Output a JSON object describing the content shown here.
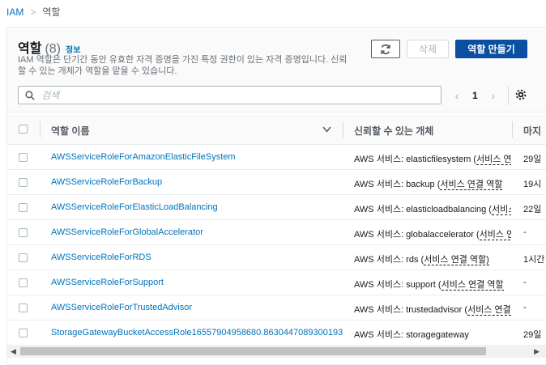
{
  "breadcrumb": {
    "root": "IAM",
    "separator": ">",
    "current": "역할"
  },
  "header": {
    "title": "역할",
    "count": "(8)",
    "info": "정보",
    "description": "IAM 역할은 단기간 동안 유효한 자격 증명을 가진 특정 권한이 있는 자격 증명입니다. 신뢰할 수 있는 개체가 역할을 맡을 수 있습니다."
  },
  "buttons": {
    "delete": "삭제",
    "create": "역할 만들기"
  },
  "search": {
    "placeholder": "검색",
    "value": ""
  },
  "pagination": {
    "prev": "‹",
    "page": "1",
    "next": "›"
  },
  "table": {
    "columns": {
      "role_name": "역할 이름",
      "trusted_entity": "신뢰할 수 있는 개체",
      "last_activity": "마지"
    },
    "rows": [
      {
        "name": "AWSServiceRoleForAmazonElasticFileSystem",
        "trust_prefix": "AWS 서비스: elasticfilesystem (",
        "trust_hint": "서비스 연",
        "last": "29일"
      },
      {
        "name": "AWSServiceRoleForBackup",
        "trust_prefix": "AWS 서비스: backup (",
        "trust_hint": "서비스 연결 역할",
        "last": "19시"
      },
      {
        "name": "AWSServiceRoleForElasticLoadBalancing",
        "trust_prefix": "AWS 서비스: elasticloadbalancing (",
        "trust_hint": "서비스",
        "last": "22일"
      },
      {
        "name": "AWSServiceRoleForGlobalAccelerator",
        "trust_prefix": "AWS 서비스: globalaccelerator (",
        "trust_hint": "서비스 연",
        "last": "-"
      },
      {
        "name": "AWSServiceRoleForRDS",
        "trust_prefix": "AWS 서비스: rds (",
        "trust_hint": "서비스 연결 역할)",
        "last": "1시간"
      },
      {
        "name": "AWSServiceRoleForSupport",
        "trust_prefix": "AWS 서비스: support (",
        "trust_hint": "서비스 연결 역할",
        "last": "-"
      },
      {
        "name": "AWSServiceRoleForTrustedAdvisor",
        "trust_prefix": "AWS 서비스: trustedadvisor (",
        "trust_hint": "서비스 연결",
        "last": "-"
      },
      {
        "name": "StorageGatewayBucketAccessRole16557904958680.8630447089300193",
        "trust_prefix": "AWS 서비스: storagegateway",
        "trust_hint": "",
        "last": "29일"
      }
    ]
  },
  "icons": {
    "search": "search-icon",
    "refresh": "refresh-icon",
    "settings": "gear-icon",
    "sort": "sort-down-icon"
  },
  "colors": {
    "link": "#0073bb",
    "primary_button": "#0a4fa1",
    "disabled_text": "#aab7b8"
  }
}
